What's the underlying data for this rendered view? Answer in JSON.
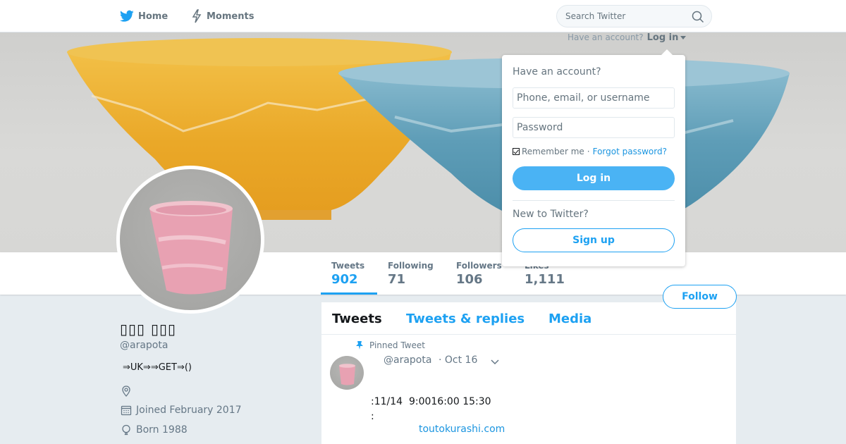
{
  "nav": {
    "home_label": "Home",
    "moments_label": "Moments",
    "search_placeholder": "Search Twitter",
    "login_prompt": "Have an account?",
    "login_link": "Log in"
  },
  "login_panel": {
    "title": "Have an account?",
    "username_placeholder": "Phone, email, or username",
    "password_placeholder": "Password",
    "remember_label": "Remember me",
    "separator": "·",
    "forgot_label": "Forgot password?",
    "login_button": "Log in",
    "new_prompt": "New to Twitter?",
    "signup_button": "Sign up"
  },
  "stats": [
    {
      "label": "Tweets",
      "value": "902",
      "active": true
    },
    {
      "label": "Following",
      "value": "71"
    },
    {
      "label": "Followers",
      "value": "106"
    },
    {
      "label": "Likes",
      "value": "1,111"
    }
  ],
  "follow_button": "Follow",
  "profile": {
    "name": "▯▯▯ ▯▯▯",
    "handle": "@arapota",
    "bio": "⇒UK⇒⇒GET⇒()",
    "location": "",
    "joined": "Joined February 2017",
    "born": "Born 1988"
  },
  "timeline": {
    "tabs": [
      {
        "label": "Tweets",
        "active": true
      },
      {
        "label": "Tweets & replies"
      },
      {
        "label": "Media"
      }
    ],
    "pinned_label": "Pinned Tweet",
    "tweet": {
      "handle": "@arapota",
      "date": "· Oct 16",
      "line1": ":11/14  9:0016:00 15:30",
      "line2": ":",
      "link": "toutokurashi.com"
    }
  },
  "colors": {
    "accent": "#1da1f2",
    "login_button_bg": "#4ab3f4",
    "background": "#e6ecf0",
    "banner_yellow_bowl": "#f0b528",
    "banner_blue_bowl": "#6aa6be",
    "cup_pink": "#e8a1b2"
  },
  "icons": {
    "home": "bird-icon",
    "moments": "lightning-icon",
    "search": "search-icon",
    "pin": "pin-icon",
    "location": "location-icon",
    "calendar": "calendar-icon",
    "balloon": "balloon-icon",
    "chevron": "chevron-down-icon"
  }
}
